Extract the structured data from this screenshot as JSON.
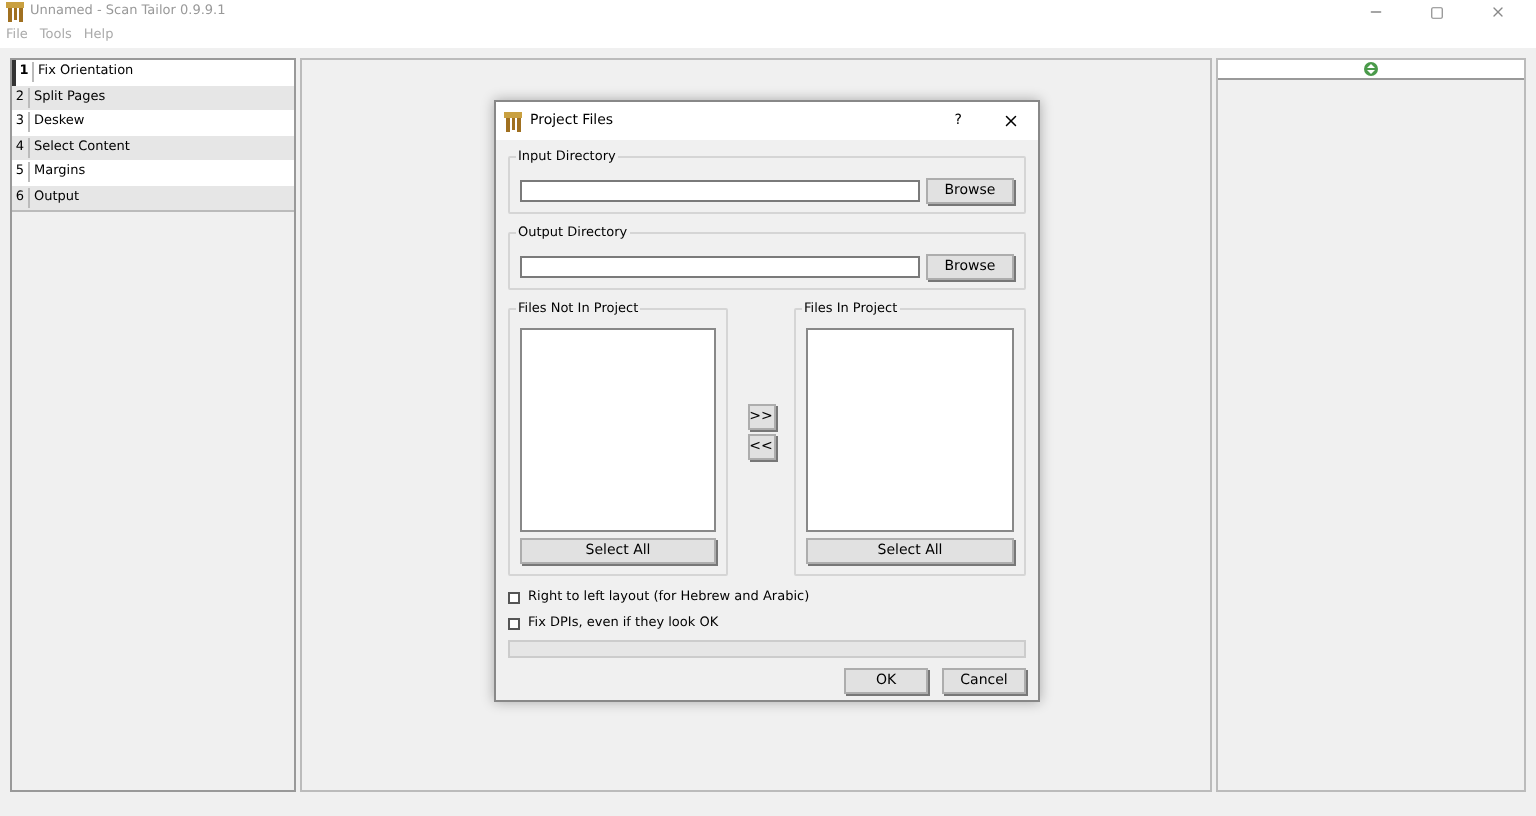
{
  "window": {
    "title": "Unnamed - Scan Tailor 0.9.9.1"
  },
  "menu": [
    "File",
    "Tools",
    "Help"
  ],
  "stages": [
    {
      "number": "1",
      "label": "Fix Orientation",
      "selected": true
    },
    {
      "number": "2",
      "label": "Split Pages",
      "selected": false
    },
    {
      "number": "3",
      "label": "Deskew",
      "selected": false
    },
    {
      "number": "4",
      "label": "Select Content",
      "selected": false
    },
    {
      "number": "5",
      "label": "Margins",
      "selected": false
    },
    {
      "number": "6",
      "label": "Output",
      "selected": false
    }
  ],
  "dialog": {
    "title": "Project Files",
    "help": "?",
    "input_directory": {
      "label": "Input Directory",
      "button": "Browse"
    },
    "output_directory": {
      "label": "Output Directory",
      "button": "Browse"
    },
    "files_not_in_project": {
      "label": "Files Not In Project",
      "button": "Select All"
    },
    "files_in_project": {
      "label": "Files In Project",
      "button": "Select All"
    },
    "move_buttons": [
      ">>",
      "<<"
    ],
    "options": [
      {
        "label": "Right to left layout (for Hebrew and Arabic)",
        "checked": false
      },
      {
        "label": "Fix DPIs, even if they look OK",
        "checked": false
      }
    ],
    "buttons": [
      "OK",
      "Cancel"
    ]
  }
}
